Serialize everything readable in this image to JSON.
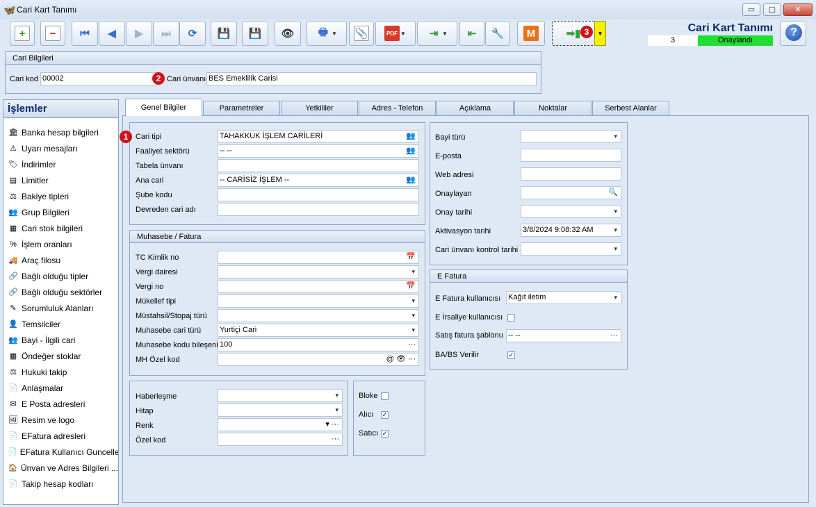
{
  "window": {
    "title": "Cari Kart Tanımı",
    "controls": [
      "▭",
      "▢",
      "✕"
    ]
  },
  "header": {
    "title": "Cari Kart Tanımı",
    "count": "3",
    "status": "Onaylandı",
    "status_color": "#22dd33",
    "help": "?"
  },
  "toolbar": {
    "m_label": "M",
    "badge": "3"
  },
  "cari": {
    "group": "Cari Bilgileri",
    "kod_label": "Cari kod",
    "kod_value": "00002",
    "unvan_label": "Cari ünvanı",
    "unvan_value": "BES Emeklilik Carisi",
    "badge": "2"
  },
  "sidebar": {
    "title": "İşlemler",
    "items": [
      {
        "label": "Banka hesap bilgileri",
        "icon": "bank-icon"
      },
      {
        "label": "Uyarı mesajları",
        "icon": "warning-icon"
      },
      {
        "label": "İndirimler",
        "icon": "tag-icon"
      },
      {
        "label": "Limitler",
        "icon": "list-icon"
      },
      {
        "label": "Bakiye tipleri",
        "icon": "balance-icon"
      },
      {
        "label": "Grup Bilgileri",
        "icon": "group-icon"
      },
      {
        "label": "Cari stok bilgileri",
        "icon": "stock-icon"
      },
      {
        "label": "İşlem oranları",
        "icon": "percent-icon"
      },
      {
        "label": "Araç filosu",
        "icon": "vehicle-icon"
      },
      {
        "label": "Bağlı olduğu tipler",
        "icon": "link-icon"
      },
      {
        "label": "Bağlı olduğu sektörler",
        "icon": "sector-icon"
      },
      {
        "label": "Sorumluluk Alanları",
        "icon": "responsibility-icon"
      },
      {
        "label": "Temsilciler",
        "icon": "person-icon"
      },
      {
        "label": "Bayi - İlgili cari",
        "icon": "dealer-icon"
      },
      {
        "label": "Öndeğer stoklar",
        "icon": "default-stock-icon"
      },
      {
        "label": "Hukuki takip",
        "icon": "legal-icon"
      },
      {
        "label": "Anlaşmalar",
        "icon": "agreement-icon"
      },
      {
        "label": "E Posta adresleri",
        "icon": "mail-icon"
      },
      {
        "label": "Resim ve logo",
        "icon": "image-icon"
      },
      {
        "label": "EFatura adresleri",
        "icon": "efatura-icon"
      },
      {
        "label": "EFatura Kullanıcı Guncelle",
        "icon": "efatura-update-icon"
      },
      {
        "label": "Ünvan ve Adres Bilgileri ...",
        "icon": "address-icon"
      },
      {
        "label": "Takip hesap kodları",
        "icon": "account-code-icon"
      }
    ]
  },
  "tabs": [
    "Genel Bilgiler",
    "Parametreler",
    "Yetkililer",
    "Adres - Telefon",
    "Açıklama",
    "Noktalar",
    "Serbest Alanlar"
  ],
  "genel": {
    "badge": "1",
    "fields": [
      {
        "label": "Cari tipi",
        "value": "TAHAKKUK İŞLEM CARİLERİ"
      },
      {
        "label": "Faaliyet sektörü",
        "value": "-- --"
      },
      {
        "label": "Tabela ünvanı",
        "value": ""
      },
      {
        "label": "Ana cari",
        "value": "-- CARİSİZ İŞLEM --"
      },
      {
        "label": "Şube kodu",
        "value": ""
      },
      {
        "label": "Devreden cari adı",
        "value": ""
      }
    ]
  },
  "muhasebe": {
    "title": "Muhasebe / Fatura",
    "fields": [
      {
        "label": "TC Kimlik no",
        "value": ""
      },
      {
        "label": "Vergi dairesi",
        "value": ""
      },
      {
        "label": "Vergi no",
        "value": ""
      },
      {
        "label": "Mükellef tipi",
        "value": ""
      },
      {
        "label": "Müstahsil/Stopaj türü",
        "value": ""
      },
      {
        "label": "Muhasebe cari türü",
        "value": "Yurtiçi Cari"
      },
      {
        "label": "Muhasebe kodu bileşeni",
        "value": "100"
      },
      {
        "label": "MH Özel kod",
        "value": ""
      }
    ]
  },
  "misc": {
    "fields": [
      {
        "label": "Haberleşme",
        "value": ""
      },
      {
        "label": "Hitap",
        "value": ""
      },
      {
        "label": "Renk",
        "value": ""
      },
      {
        "label": "Özel kod",
        "value": ""
      }
    ]
  },
  "flags": [
    {
      "label": "Bloke",
      "checked": ""
    },
    {
      "label": "Alıcı",
      "checked": "✓"
    },
    {
      "label": "Satıcı",
      "checked": "✓"
    }
  ],
  "right": {
    "fields": [
      {
        "label": "Bayi türü",
        "value": ""
      },
      {
        "label": "E-posta",
        "value": ""
      },
      {
        "label": "Web adresi",
        "value": ""
      },
      {
        "label": "Onaylayan",
        "value": ""
      },
      {
        "label": "Onay tarihi",
        "value": ""
      },
      {
        "label": "Aktivasyon tarihi",
        "value": "3/8/2024 9:08:32 AM"
      },
      {
        "label": "Cari ünvanı kontrol tarihi",
        "value": ""
      }
    ]
  },
  "efatura": {
    "title": "E Fatura",
    "kullanici_label": "E Fatura kullanıcısı",
    "kullanici_value": "Kağıt iletim",
    "irsaliye_label": "E İrsaliye kullanıcısı",
    "irsaliye_checked": "",
    "sablon_label": "Satış fatura şablonu",
    "sablon_value": "-- --",
    "babs_label": "BA/BS Verilir",
    "babs_checked": "✓"
  }
}
